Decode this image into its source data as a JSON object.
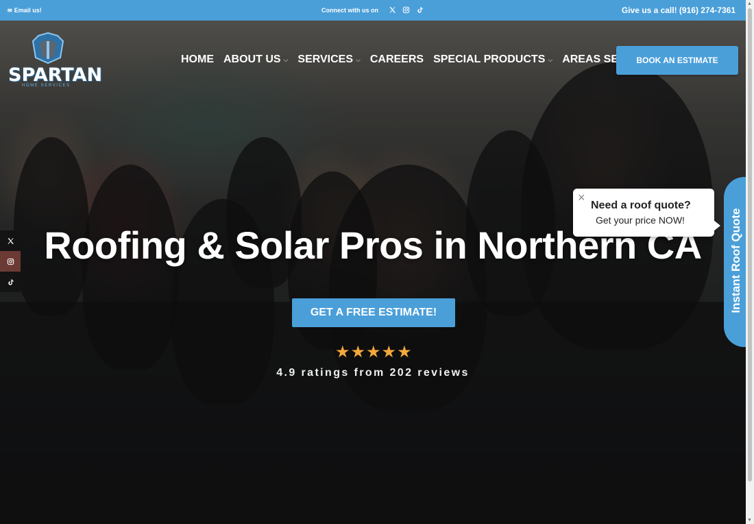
{
  "topbar": {
    "email_label": "Email us!",
    "connect_label": "Connect with us on",
    "socials": [
      "x-icon",
      "instagram-icon",
      "tiktok-icon"
    ],
    "call_label": "Give us a call! (916) 274-7361"
  },
  "logo": {
    "word": "SPARTAN",
    "subtitle": "HOME SERVICES"
  },
  "nav": {
    "items": [
      {
        "label": "HOME",
        "dropdown": false
      },
      {
        "label": "ABOUT US",
        "dropdown": true
      },
      {
        "label": "SERVICES",
        "dropdown": true
      },
      {
        "label": "CAREERS",
        "dropdown": false
      },
      {
        "label": "SPECIAL PRODUCTS",
        "dropdown": true
      },
      {
        "label": "AREAS SERVED",
        "dropdown": false
      }
    ],
    "book_button": "BOOK AN ESTIMATE"
  },
  "hero": {
    "headline": "Roofing & Solar Pros in Northern CA",
    "cta": "GET A FREE ESTIMATE!",
    "stars": 5,
    "rating_text": "4.9 ratings from 202 reviews"
  },
  "quote_popup": {
    "title": "Need a roof quote?",
    "subtitle": "Get your price NOW!",
    "tab_label": "Instant Roof Quote"
  },
  "colors": {
    "accent": "#4a9fd9",
    "star": "#f3a83b"
  }
}
